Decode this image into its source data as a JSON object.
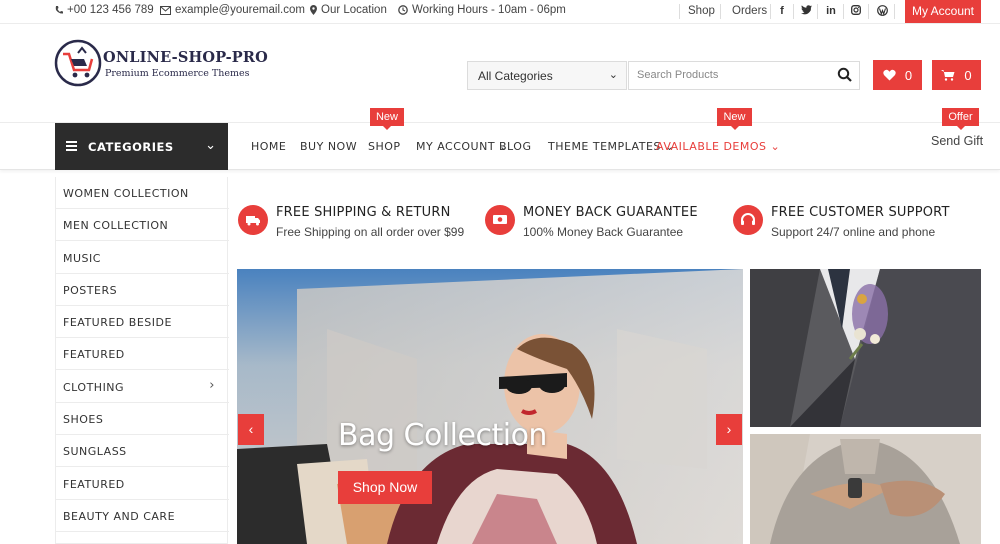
{
  "topbar": {
    "phone": "+00 123 456 789",
    "email": "example@youremail.com",
    "location": "Our Location",
    "hours": "Working Hours - 10am - 06pm",
    "links": [
      "Shop",
      "Orders"
    ],
    "social_icons": [
      "facebook-icon",
      "twitter-icon",
      "linkedin-icon",
      "instagram-icon",
      "wordpress-icon"
    ],
    "my_account": "My Account"
  },
  "header": {
    "logo_title": "ONLINE-SHOP-PRO",
    "logo_subtitle": "Premium Ecommerce Themes",
    "category_select": "All Categories",
    "search_placeholder": "Search Products",
    "wishlist_count": "0",
    "cart_count": "0"
  },
  "nav": {
    "categories_label": "CATEGORIES",
    "items": [
      "HOME",
      "BUY NOW",
      "SHOP",
      "MY ACCOUNT",
      "BLOG",
      "THEME TEMPLATES",
      "AVAILABLE DEMOS"
    ],
    "badges": {
      "shop": "New",
      "demos": "New",
      "gift": "Offer"
    },
    "send_gift": "Send Gift"
  },
  "sidebar": {
    "items": [
      "WOMEN COLLECTION",
      "MEN COLLECTION",
      "MUSIC",
      "POSTERS",
      "FEATURED BESIDE",
      "FEATURED",
      "CLOTHING",
      "SHOES",
      "SUNGLASS",
      "FEATURED",
      "BEAUTY AND CARE"
    ]
  },
  "features": [
    {
      "title": "FREE SHIPPING & RETURN",
      "subtitle": "Free Shipping on all order over $99"
    },
    {
      "title": "MONEY BACK GUARANTEE",
      "subtitle": "100% Money Back Guarantee"
    },
    {
      "title": "FREE CUSTOMER SUPPORT",
      "subtitle": "Support 24/7 online and phone"
    }
  ],
  "slider": {
    "title": "Bag Collection",
    "button": "Shop Now"
  },
  "colors": {
    "accent": "#e83e3b",
    "dark": "#2c2c2c"
  }
}
